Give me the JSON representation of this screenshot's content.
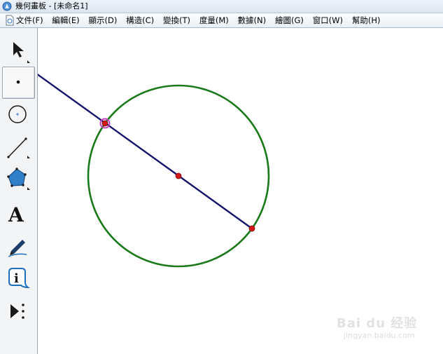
{
  "window": {
    "title": "幾何畫板 - [未命名1]"
  },
  "menu": {
    "items": [
      "文件(F)",
      "編輯(E)",
      "顯示(D)",
      "構造(C)",
      "變換(T)",
      "度量(M)",
      "數據(N)",
      "繪圖(G)",
      "窗口(W)",
      "幫助(H)"
    ]
  },
  "toolbox": {
    "tools": [
      {
        "name": "arrow-tool",
        "icon": "arrow-select-icon"
      },
      {
        "name": "point-tool",
        "icon": "point-icon",
        "selected": true
      },
      {
        "name": "compass-tool",
        "icon": "circle-compass-icon"
      },
      {
        "name": "straightedge-tool",
        "icon": "segment-icon"
      },
      {
        "name": "polygon-tool",
        "icon": "pentagon-icon"
      },
      {
        "name": "text-tool",
        "icon": "text-a-icon",
        "label": "A"
      },
      {
        "name": "marker-tool",
        "icon": "pen-marker-icon"
      },
      {
        "name": "info-tool",
        "icon": "info-icon",
        "label": "i"
      },
      {
        "name": "custom-tool",
        "icon": "custom-tools-icon"
      }
    ]
  },
  "colors": {
    "circle": "#1a7a1a",
    "line": "#14146b",
    "point": "#d21818",
    "highlight": "#c040c0"
  },
  "watermark": {
    "brand": "Bai du 经验",
    "site": "jingyan.baidu.com"
  }
}
